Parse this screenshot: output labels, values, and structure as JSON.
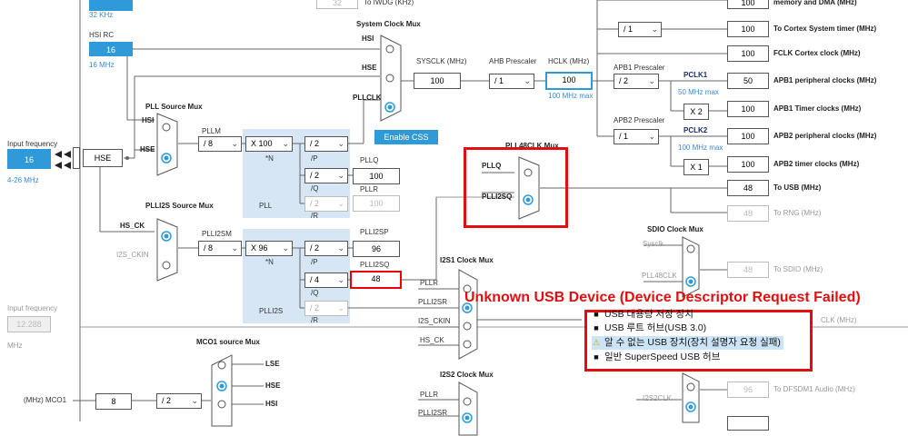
{
  "lse": {
    "freq_unit": "32 KHz"
  },
  "top": {
    "iwdg_value": "32",
    "iwdg_label": "To IWDG (KHz)"
  },
  "hsi": {
    "title": "HSI RC",
    "value": "16",
    "unit": "16 MHz"
  },
  "input_freq": {
    "label": "Input frequency",
    "value": "16",
    "range": "4-26 MHz"
  },
  "hse": {
    "label": "HSE"
  },
  "sysclk_mux": {
    "title": "System Clock Mux",
    "in_hsi": "HSI",
    "in_hse": "HSE",
    "in_pllclk": "PLLCLK"
  },
  "enable_css": "Enable CSS",
  "sysclk": {
    "label": "SYSCLK (MHz)",
    "value": "100"
  },
  "ahb": {
    "label": "AHB Prescaler",
    "value": "/ 1"
  },
  "hclk": {
    "label": "HCLK (MHz)",
    "value": "100",
    "max": "100 MHz max"
  },
  "apb1": {
    "label": "APB1 Prescaler",
    "value": "/ 2",
    "pclk": "PCLK1",
    "max": "50 MHz max"
  },
  "apb2": {
    "label": "APB2 Prescaler",
    "value": "/ 1",
    "pclk": "PCLK2",
    "max": "100 MHz max"
  },
  "outputs": {
    "memdma": {
      "value": "100",
      "label": "memory and DMA (MHz)"
    },
    "cortex_sel": "/ 1",
    "cortex_timer": {
      "value": "100",
      "label": "To Cortex System timer (MHz)"
    },
    "fclk": {
      "value": "100",
      "label": "FCLK Cortex clock (MHz)"
    },
    "apb1_periph": {
      "value": "50",
      "label": "APB1 peripheral clocks (MHz)"
    },
    "apb1_mult": "X 2",
    "apb1_timer": {
      "value": "100",
      "label": "APB1 Timer clocks (MHz)"
    },
    "apb2_periph": {
      "value": "100",
      "label": "APB2 peripheral clocks (MHz)"
    },
    "apb2_mult": "X 1",
    "apb2_timer": {
      "value": "100",
      "label": "APB2 timer clocks (MHz)"
    },
    "usb": {
      "value": "48",
      "label": "To USB (MHz)"
    },
    "rng": {
      "value": "48",
      "label": "To RNG (MHz)"
    },
    "sdio": {
      "value": "48",
      "label": "To SDIO (MHz)"
    },
    "i2s_clk_label": "CLK (MHz)",
    "dfsdm": {
      "value": "96",
      "label": "To DFSDM1 Audio (MHz)"
    }
  },
  "pll_src": {
    "title": "PLL Source Mux",
    "in_hsi": "HSI",
    "in_hse": "HSE"
  },
  "pll": {
    "m_label": "PLLM",
    "m": "/ 8",
    "n": "X 100",
    "n_label": "*N",
    "p": "/ 2",
    "p_label": "/P",
    "q": "/ 2",
    "q_label": "/Q",
    "r": "/ 2",
    "r_label": "/R",
    "name": "PLL",
    "q_out_label": "PLLQ",
    "q_out": "100",
    "r_out_label": "PLLR",
    "r_out": "100"
  },
  "pll48": {
    "title": "PLL48CLK Mux",
    "in_q": "PLLQ",
    "in_i2sq": "PLLI2SQ"
  },
  "plli2s_src": {
    "title": "PLLI2S Source Mux",
    "in_hsck": "HS_CK",
    "in_i2sckin": "I2S_CKIN"
  },
  "plli2s": {
    "m_label": "PLLI2SM",
    "m": "/ 8",
    "n": "X 96",
    "n_label": "*N",
    "p": "/ 2",
    "p_label": "/P",
    "q": "/ 4",
    "q_label": "/Q",
    "r": "/ 2",
    "r_label": "/R",
    "name": "PLLI2S",
    "p_out_label": "PLLI2SP",
    "p_out": "96",
    "q_out_label": "PLLI2SQ",
    "q_out": "48"
  },
  "i2s1": {
    "title": "I2S1 Clock Mux",
    "in_pllr": "PLLR",
    "in_plli2sr": "PLLI2SR",
    "in_ckin": "I2S_CKIN",
    "in_hsck": "HS_CK"
  },
  "i2s2": {
    "title": "I2S2 Clock Mux",
    "in_pllr": "PLLR",
    "in_plli2sr": "PLLI2SR",
    "i2s2clk": "I2S2CLK"
  },
  "sdio_mux": {
    "title": "SDIO Clock Mux",
    "in_sysclk": "Sysclk",
    "in_pll48": "PLL48CLK"
  },
  "input_freq2": {
    "label": "Input frequency",
    "value": "12.288",
    "unit": "MHz"
  },
  "mco1": {
    "title": "MCO1 source Mux",
    "in_lse": "LSE",
    "in_hse": "HSE",
    "in_hsi": "HSI",
    "label": "(MHz) MCO1",
    "value": "8",
    "div": "/ 2"
  },
  "usb_error": {
    "title": "Unknown USB Device (Device Descriptor Request Failed)",
    "items": [
      {
        "text": "USB 대용량 저장 장치",
        "icon": "usb-plug-icon"
      },
      {
        "text": "USB 루트 허브(USB 3.0)",
        "icon": "usb-plug-icon"
      },
      {
        "text": "알 수 없는 USB 장치(장치 설명자 요청 실패)",
        "icon": "warning-icon"
      },
      {
        "text": "일반 SuperSpeed USB 허브",
        "icon": "usb-plug-icon"
      }
    ]
  },
  "colors": {
    "accent": "#2e9bd8",
    "error": "#e01010",
    "pll_region": "#d6e6f4"
  }
}
